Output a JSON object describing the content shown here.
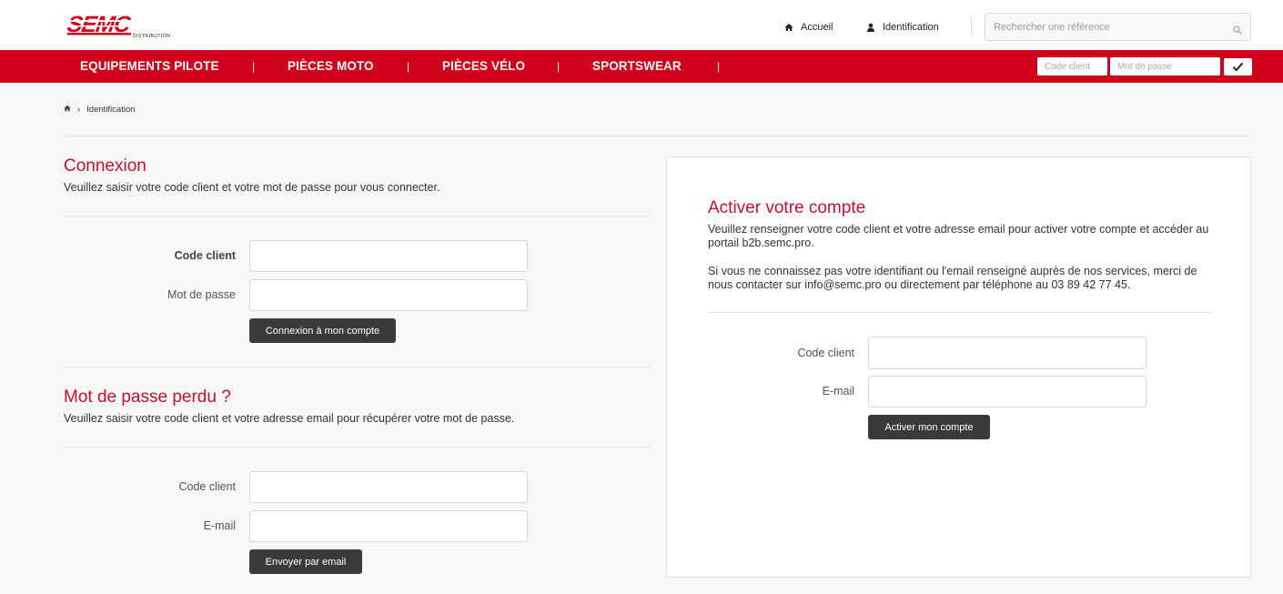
{
  "header": {
    "logo_text": "SEMC",
    "logo_sub": "DISTRIBUTION",
    "home_label": "Accueil",
    "ident_label": "Identification",
    "search_placeholder": "Rechercher une référence"
  },
  "nav": {
    "items": [
      {
        "label": "EQUIPEMENTS PILOTE"
      },
      {
        "label": "PIÈCES MOTO"
      },
      {
        "label": "PIÈCES VÉLO"
      },
      {
        "label": "SPORTSWEAR"
      }
    ],
    "separator": "|",
    "login_code_placeholder": "Code client",
    "login_pass_placeholder": "Mot de passe"
  },
  "breadcrumb": {
    "separator": "›",
    "current": "Identification"
  },
  "connexion": {
    "title": "Connexion",
    "desc": "Veuillez saisir votre code client et votre mot de passe pour vous connecter.",
    "code_label": "Code client",
    "pass_label": "Mot de passe",
    "button": "Connexion à mon compte"
  },
  "lost": {
    "title": "Mot de passe perdu ?",
    "desc": "Veuillez saisir votre code client et votre adresse email pour récupérer votre mot de passe.",
    "code_label": "Code client",
    "email_label": "E-mail",
    "button": "Envoyer par email"
  },
  "activate": {
    "title": "Activer votre compte",
    "desc1": "Veuillez renseigner votre code client et votre adresse email pour activer votre compte et accéder au portail b2b.semc.pro.",
    "desc2": "Si vous ne connaissez pas votre identifiant ou l'email renseigné auprès de nos services, merci de nous contacter sur info@semc.pro ou directement par téléphone au 03 89 42 77 45.",
    "code_label": "Code client",
    "email_label": "E-mail",
    "button": "Activer mon compte"
  },
  "colors": {
    "brand_red": "#d0021b",
    "title_red": "#c8102e",
    "button_dark": "#3a3a3a"
  }
}
